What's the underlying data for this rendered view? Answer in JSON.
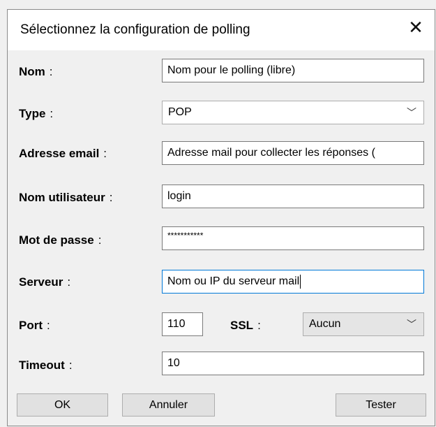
{
  "window": {
    "title": "Sélectionnez la configuration de polling",
    "close_icon": "close-icon"
  },
  "fields": {
    "nom": {
      "label": "Nom",
      "colon": ":",
      "value": "Nom pour le polling (libre)"
    },
    "type": {
      "label": "Type",
      "colon": ":",
      "value": "POP"
    },
    "email": {
      "label": "Adresse email",
      "colon": ":",
      "value": "Adresse mail pour collecter les réponses ("
    },
    "user": {
      "label": "Nom utilisateur",
      "colon": ":",
      "value": "login"
    },
    "password": {
      "label": "Mot de passe",
      "colon": ":",
      "value": "***********"
    },
    "server": {
      "label": "Serveur",
      "colon": ":",
      "value": "Nom ou IP du serveur mail"
    },
    "port": {
      "label": "Port",
      "colon": ":",
      "value": "110"
    },
    "ssl": {
      "label": "SSL",
      "colon": ":",
      "value": "Aucun"
    },
    "timeout": {
      "label": "Timeout",
      "colon": ":",
      "value": "10"
    }
  },
  "buttons": {
    "ok": "OK",
    "cancel": "Annuler",
    "test": "Tester"
  },
  "icons": {
    "dropdown": "chevron-down-icon"
  },
  "colors": {
    "focus": "#0078d7",
    "background": "#f0f0f0"
  }
}
